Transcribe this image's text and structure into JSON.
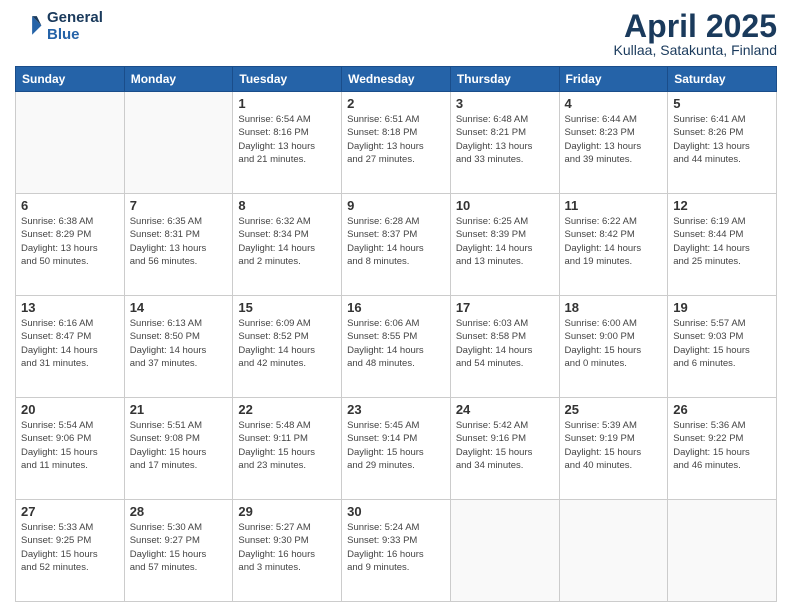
{
  "logo": {
    "line1": "General",
    "line2": "Blue"
  },
  "title": "April 2025",
  "subtitle": "Kullaa, Satakunta, Finland",
  "days_header": [
    "Sunday",
    "Monday",
    "Tuesday",
    "Wednesday",
    "Thursday",
    "Friday",
    "Saturday"
  ],
  "weeks": [
    [
      {
        "day": "",
        "info": ""
      },
      {
        "day": "",
        "info": ""
      },
      {
        "day": "1",
        "info": "Sunrise: 6:54 AM\nSunset: 8:16 PM\nDaylight: 13 hours\nand 21 minutes."
      },
      {
        "day": "2",
        "info": "Sunrise: 6:51 AM\nSunset: 8:18 PM\nDaylight: 13 hours\nand 27 minutes."
      },
      {
        "day": "3",
        "info": "Sunrise: 6:48 AM\nSunset: 8:21 PM\nDaylight: 13 hours\nand 33 minutes."
      },
      {
        "day": "4",
        "info": "Sunrise: 6:44 AM\nSunset: 8:23 PM\nDaylight: 13 hours\nand 39 minutes."
      },
      {
        "day": "5",
        "info": "Sunrise: 6:41 AM\nSunset: 8:26 PM\nDaylight: 13 hours\nand 44 minutes."
      }
    ],
    [
      {
        "day": "6",
        "info": "Sunrise: 6:38 AM\nSunset: 8:29 PM\nDaylight: 13 hours\nand 50 minutes."
      },
      {
        "day": "7",
        "info": "Sunrise: 6:35 AM\nSunset: 8:31 PM\nDaylight: 13 hours\nand 56 minutes."
      },
      {
        "day": "8",
        "info": "Sunrise: 6:32 AM\nSunset: 8:34 PM\nDaylight: 14 hours\nand 2 minutes."
      },
      {
        "day": "9",
        "info": "Sunrise: 6:28 AM\nSunset: 8:37 PM\nDaylight: 14 hours\nand 8 minutes."
      },
      {
        "day": "10",
        "info": "Sunrise: 6:25 AM\nSunset: 8:39 PM\nDaylight: 14 hours\nand 13 minutes."
      },
      {
        "day": "11",
        "info": "Sunrise: 6:22 AM\nSunset: 8:42 PM\nDaylight: 14 hours\nand 19 minutes."
      },
      {
        "day": "12",
        "info": "Sunrise: 6:19 AM\nSunset: 8:44 PM\nDaylight: 14 hours\nand 25 minutes."
      }
    ],
    [
      {
        "day": "13",
        "info": "Sunrise: 6:16 AM\nSunset: 8:47 PM\nDaylight: 14 hours\nand 31 minutes."
      },
      {
        "day": "14",
        "info": "Sunrise: 6:13 AM\nSunset: 8:50 PM\nDaylight: 14 hours\nand 37 minutes."
      },
      {
        "day": "15",
        "info": "Sunrise: 6:09 AM\nSunset: 8:52 PM\nDaylight: 14 hours\nand 42 minutes."
      },
      {
        "day": "16",
        "info": "Sunrise: 6:06 AM\nSunset: 8:55 PM\nDaylight: 14 hours\nand 48 minutes."
      },
      {
        "day": "17",
        "info": "Sunrise: 6:03 AM\nSunset: 8:58 PM\nDaylight: 14 hours\nand 54 minutes."
      },
      {
        "day": "18",
        "info": "Sunrise: 6:00 AM\nSunset: 9:00 PM\nDaylight: 15 hours\nand 0 minutes."
      },
      {
        "day": "19",
        "info": "Sunrise: 5:57 AM\nSunset: 9:03 PM\nDaylight: 15 hours\nand 6 minutes."
      }
    ],
    [
      {
        "day": "20",
        "info": "Sunrise: 5:54 AM\nSunset: 9:06 PM\nDaylight: 15 hours\nand 11 minutes."
      },
      {
        "day": "21",
        "info": "Sunrise: 5:51 AM\nSunset: 9:08 PM\nDaylight: 15 hours\nand 17 minutes."
      },
      {
        "day": "22",
        "info": "Sunrise: 5:48 AM\nSunset: 9:11 PM\nDaylight: 15 hours\nand 23 minutes."
      },
      {
        "day": "23",
        "info": "Sunrise: 5:45 AM\nSunset: 9:14 PM\nDaylight: 15 hours\nand 29 minutes."
      },
      {
        "day": "24",
        "info": "Sunrise: 5:42 AM\nSunset: 9:16 PM\nDaylight: 15 hours\nand 34 minutes."
      },
      {
        "day": "25",
        "info": "Sunrise: 5:39 AM\nSunset: 9:19 PM\nDaylight: 15 hours\nand 40 minutes."
      },
      {
        "day": "26",
        "info": "Sunrise: 5:36 AM\nSunset: 9:22 PM\nDaylight: 15 hours\nand 46 minutes."
      }
    ],
    [
      {
        "day": "27",
        "info": "Sunrise: 5:33 AM\nSunset: 9:25 PM\nDaylight: 15 hours\nand 52 minutes."
      },
      {
        "day": "28",
        "info": "Sunrise: 5:30 AM\nSunset: 9:27 PM\nDaylight: 15 hours\nand 57 minutes."
      },
      {
        "day": "29",
        "info": "Sunrise: 5:27 AM\nSunset: 9:30 PM\nDaylight: 16 hours\nand 3 minutes."
      },
      {
        "day": "30",
        "info": "Sunrise: 5:24 AM\nSunset: 9:33 PM\nDaylight: 16 hours\nand 9 minutes."
      },
      {
        "day": "",
        "info": ""
      },
      {
        "day": "",
        "info": ""
      },
      {
        "day": "",
        "info": ""
      }
    ]
  ]
}
